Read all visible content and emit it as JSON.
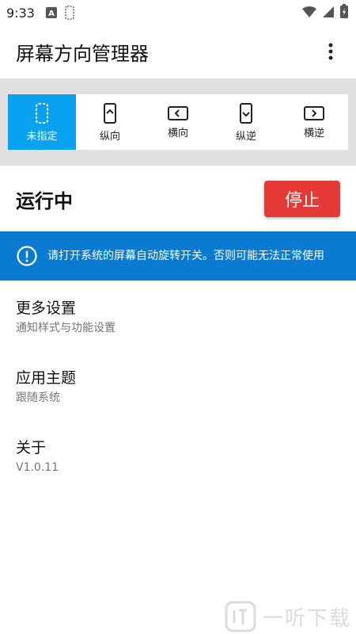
{
  "status_bar": {
    "time": "9:33"
  },
  "app_bar": {
    "title": "屏幕方向管理器"
  },
  "orientation": {
    "selected_index": 0,
    "accent_color": "#0aa1f0",
    "options": [
      {
        "label": "未指定",
        "icon": "unspecified-icon"
      },
      {
        "label": "纵向",
        "icon": "portrait-icon"
      },
      {
        "label": "横向",
        "icon": "landscape-icon"
      },
      {
        "label": "纵逆",
        "icon": "reverse-portrait-icon"
      },
      {
        "label": "横逆",
        "icon": "reverse-landscape-icon"
      }
    ]
  },
  "service": {
    "status": "运行中",
    "stop_label": "停止",
    "stop_color": "#e53935"
  },
  "banner": {
    "color": "#0a7bd1",
    "text": "请打开系统的屏幕自动旋转开关。否则可能无法正常使用"
  },
  "settings": {
    "more": {
      "title": "更多设置",
      "subtitle": "通知样式与功能设置"
    },
    "theme": {
      "title": "应用主题",
      "subtitle": "跟随系统"
    },
    "about": {
      "title": "关于",
      "subtitle": "V1.0.11"
    }
  },
  "watermark": {
    "text": "一听下载"
  }
}
